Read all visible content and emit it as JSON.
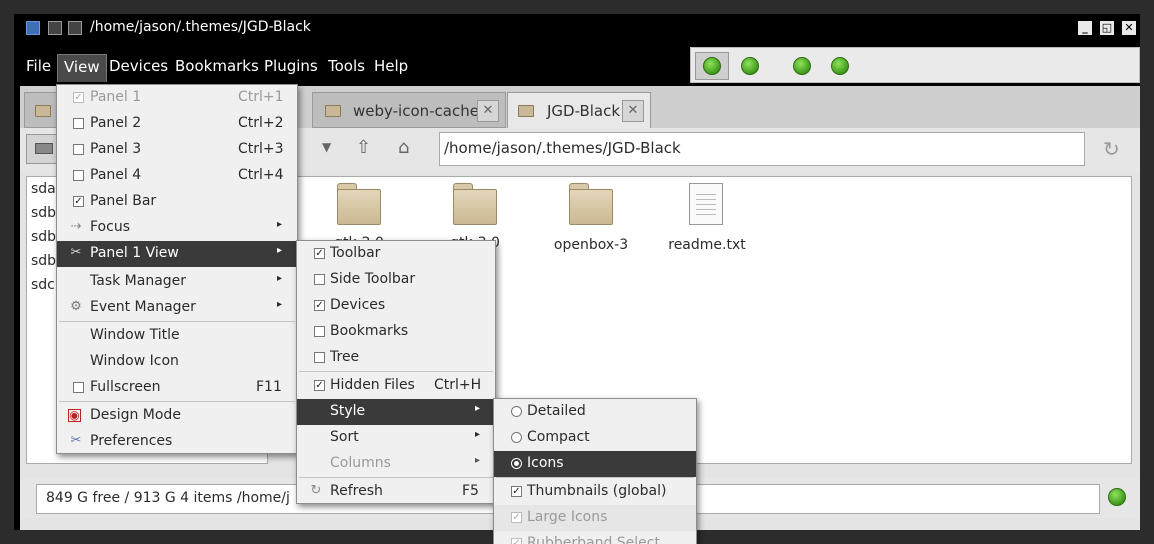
{
  "window": {
    "title": "/home/jason/.themes/JGD-Black",
    "controls": [
      "minimize-icon",
      "maximize-icon",
      "close-icon"
    ]
  },
  "menubar": {
    "items": [
      "File",
      "View",
      "Devices",
      "Bookmarks",
      "Plugins",
      "Tools",
      "Help"
    ],
    "active": "View"
  },
  "tabs": [
    {
      "label": "weby-icon-cache"
    },
    {
      "label": "JGD-Black",
      "current": true
    }
  ],
  "toolbar": {
    "path": "/home/jason/.themes/JGD-Black",
    "icons": [
      "drive-icon",
      "dropdown-arrow-icon",
      "up-icon",
      "home-icon",
      "reload-icon"
    ]
  },
  "devices": [
    "sda",
    "sdb",
    "sdb",
    "sdb",
    "sdc1"
  ],
  "files": [
    {
      "name": "gtk-2.0",
      "icon": "folder-icon"
    },
    {
      "name": "gtk-3.0",
      "icon": "folder-icon"
    },
    {
      "name": "openbox-3",
      "icon": "folder-icon"
    },
    {
      "name": "readme.txt",
      "icon": "text-file-icon"
    }
  ],
  "status": {
    "text": "849 G free / 913 G   4 items   /home/j"
  },
  "view_menu": {
    "items": [
      {
        "label": "Panel 1",
        "accel": "Ctrl+1",
        "check": true,
        "disabled": true
      },
      {
        "label": "Panel 2",
        "accel": "Ctrl+2",
        "check": false
      },
      {
        "label": "Panel 3",
        "accel": "Ctrl+3",
        "check": false
      },
      {
        "label": "Panel 4",
        "accel": "Ctrl+4",
        "check": false
      },
      {
        "label": "Panel Bar",
        "check": true
      },
      {
        "label": "Focus",
        "submenu": true
      },
      {
        "label": "Panel 1 View",
        "submenu": true,
        "highlighted": true
      },
      {
        "label": "Task Manager",
        "submenu": true
      },
      {
        "label": "Event Manager",
        "submenu": true
      },
      {
        "label": "Window Title"
      },
      {
        "label": "Window Icon"
      },
      {
        "label": "Fullscreen",
        "accel": "F11",
        "check": false
      },
      {
        "label": "Design Mode"
      },
      {
        "label": "Preferences"
      }
    ]
  },
  "panel_view_menu": {
    "items": [
      {
        "label": "Toolbar",
        "check": true
      },
      {
        "label": "Side Toolbar",
        "check": false
      },
      {
        "label": "Devices",
        "check": true
      },
      {
        "label": "Bookmarks",
        "check": false
      },
      {
        "label": "Tree",
        "check": false
      },
      {
        "label": "Hidden Files",
        "accel": "Ctrl+H",
        "check": true
      },
      {
        "label": "Style",
        "submenu": true,
        "highlighted": true
      },
      {
        "label": "Sort",
        "submenu": true
      },
      {
        "label": "Columns",
        "submenu": true,
        "disabled": true
      },
      {
        "label": "Refresh",
        "accel": "F5"
      }
    ]
  },
  "style_menu": {
    "items": [
      {
        "label": "Detailed",
        "radio": false
      },
      {
        "label": "Compact",
        "radio": false
      },
      {
        "label": "Icons",
        "radio": true,
        "highlighted": true
      },
      {
        "label": "Thumbnails (global)",
        "check": true
      },
      {
        "label": "Large Icons",
        "check": true,
        "disabled": true
      },
      {
        "label": "Rubberband Select",
        "check": true,
        "disabled": true
      }
    ]
  },
  "colors": {
    "highlight": "#3a3a3a",
    "led_green": "#4caf1f",
    "menu_bg": "#f0f0f0"
  }
}
